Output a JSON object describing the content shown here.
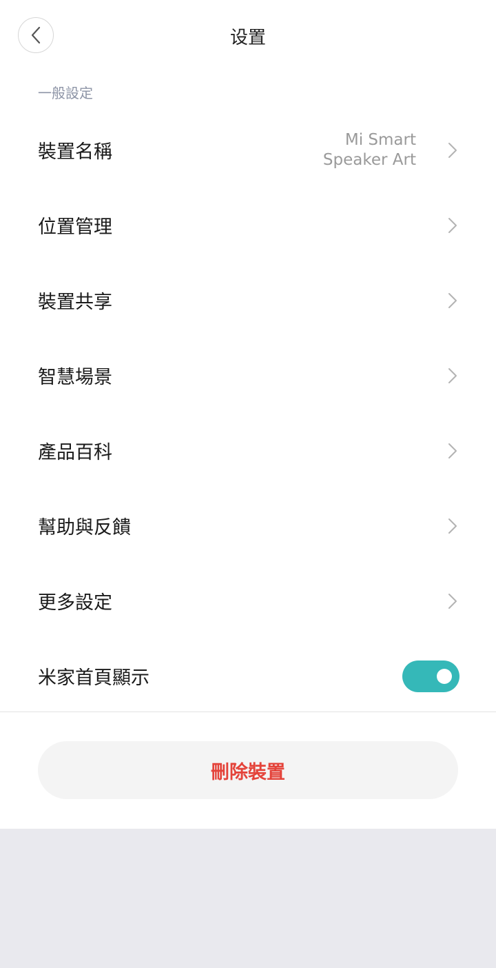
{
  "header": {
    "title": "设置",
    "back_icon": "chevron-left-icon"
  },
  "section": {
    "label": "一般設定"
  },
  "rows": [
    {
      "label": "裝置名稱",
      "value_line1": "Mi Smart",
      "value_line2": "Speaker Art"
    },
    {
      "label": "位置管理"
    },
    {
      "label": "裝置共享"
    },
    {
      "label": "智慧場景"
    },
    {
      "label": "產品百科"
    },
    {
      "label": "幫助與反饋"
    },
    {
      "label": "更多設定"
    },
    {
      "label": "米家首頁顯示",
      "toggle": true
    }
  ],
  "actions": {
    "delete_label": "刪除裝置"
  },
  "colors": {
    "toggle_on": "#35b8b8",
    "delete_text": "#e4433a",
    "section_label": "#8d94a6"
  }
}
